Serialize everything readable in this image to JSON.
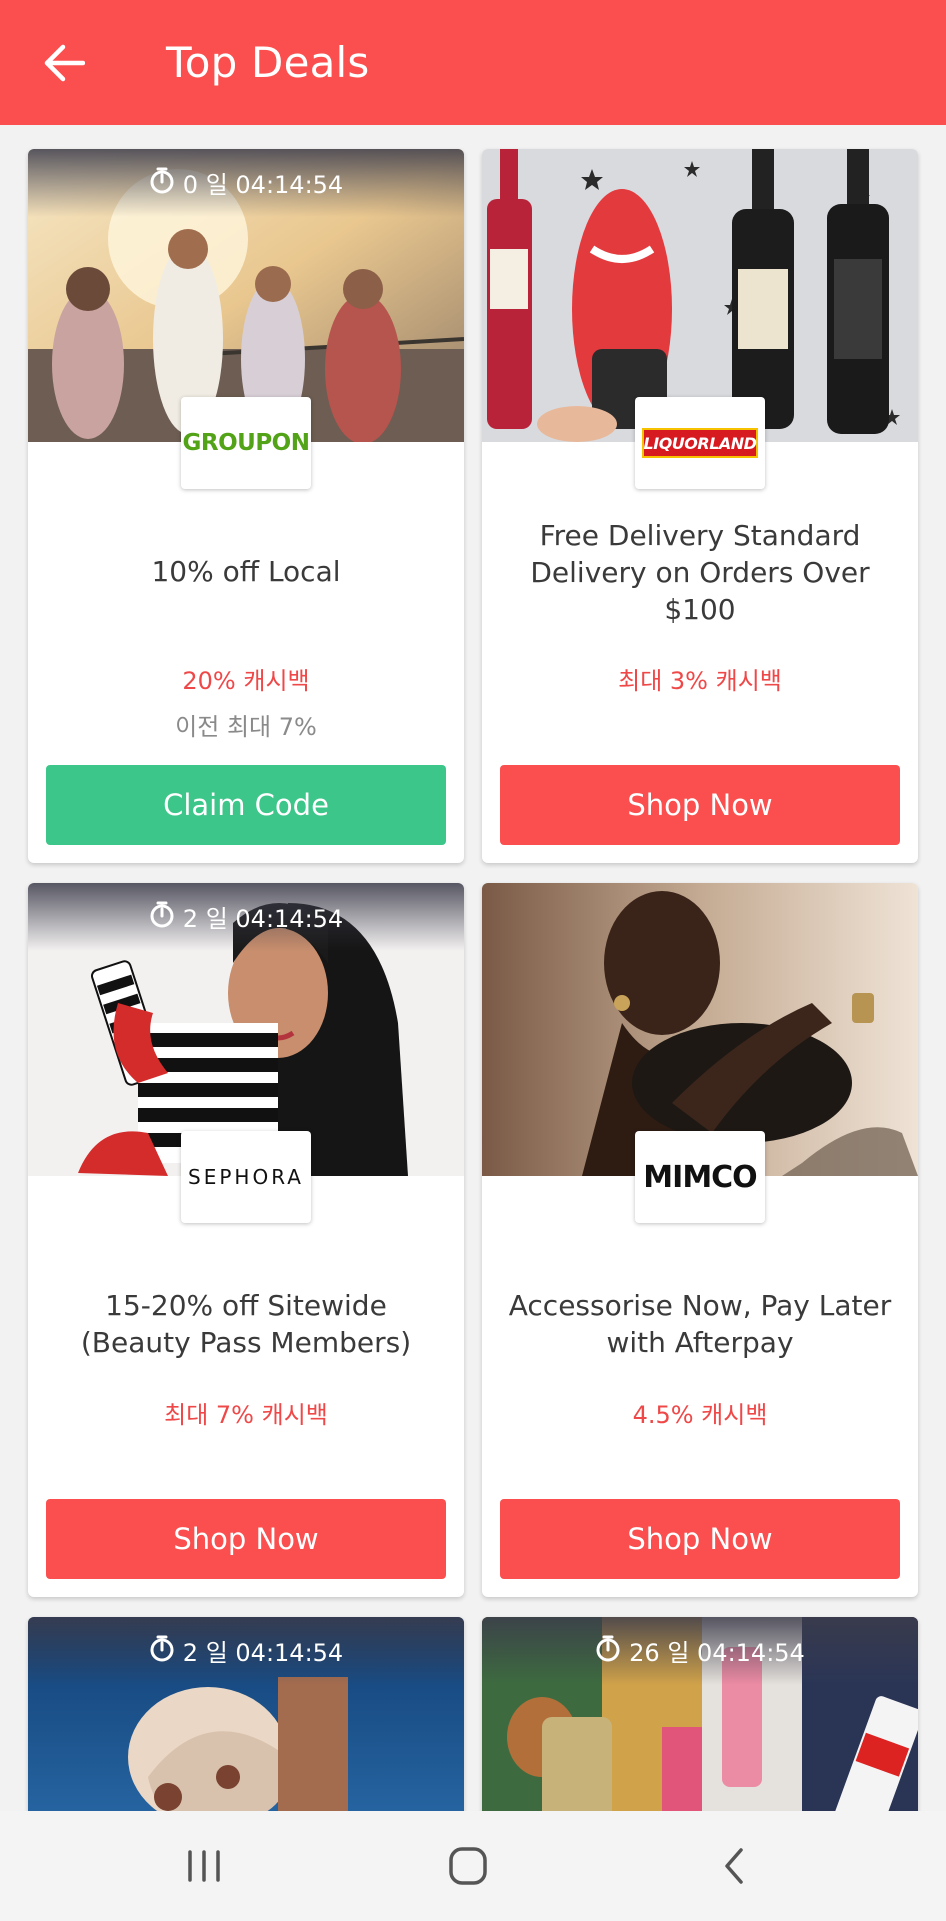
{
  "header": {
    "title": "Top Deals",
    "back_icon": "arrow-left-icon"
  },
  "deals": [
    {
      "merchant": "GROUPON",
      "timer": "0 일 04:14:54",
      "title": "10% off Local",
      "cashback": "20% 캐시백",
      "previous": "이전 최대 7%",
      "button": "Claim Code",
      "button_color": "#3cc68a"
    },
    {
      "merchant": "LIQUORLAND",
      "timer": "",
      "title": "Free Delivery Standard Delivery on Orders Over $100",
      "cashback": "최대 3% 캐시백",
      "previous": "",
      "button": "Shop Now",
      "button_color": "#fb4f4f"
    },
    {
      "merchant": "SEPHORA",
      "timer": "2 일 04:14:54",
      "title": "15-20% off Sitewide (Beauty Pass Members)",
      "cashback": "최대 7% 캐시백",
      "previous": "",
      "button": "Shop Now",
      "button_color": "#fb4f4f"
    },
    {
      "merchant": "MIMCO",
      "timer": "",
      "title": "Accessorise Now, Pay Later with Afterpay",
      "cashback": "4.5% 캐시백",
      "previous": "",
      "button": "Shop Now",
      "button_color": "#fb4f4f"
    },
    {
      "merchant": "",
      "timer": "2 일 04:14:54"
    },
    {
      "merchant": "",
      "timer": "26 일 04:14:54"
    }
  ],
  "colors": {
    "brand": "#fb4f4f",
    "claim": "#3cc68a",
    "cashback": "#ef4848"
  },
  "system_nav": {
    "recents_icon": "recents-icon",
    "home_icon": "home-icon",
    "back_icon": "back-chevron-icon"
  }
}
